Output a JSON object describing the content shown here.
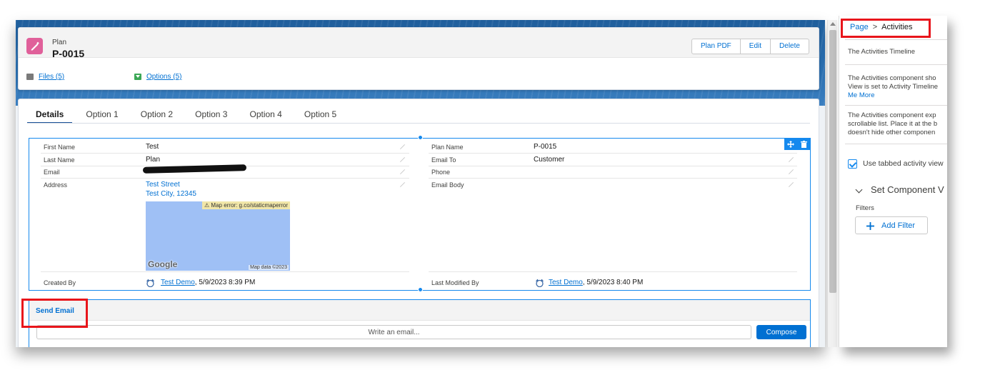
{
  "header": {
    "object_type": "Plan",
    "record_name": "P-0015",
    "actions": [
      "Plan PDF",
      "Edit",
      "Delete"
    ],
    "related_links": [
      {
        "label": "Files (5)",
        "icon": "file-icon",
        "color": "#7a7a7a"
      },
      {
        "label": "Options (5)",
        "icon": "options-icon",
        "color": "#3ba755"
      }
    ]
  },
  "tabs": [
    {
      "label": "Details",
      "active": true
    },
    {
      "label": "Option 1",
      "active": false
    },
    {
      "label": "Option 2",
      "active": false
    },
    {
      "label": "Option 3",
      "active": false
    },
    {
      "label": "Option 4",
      "active": false
    },
    {
      "label": "Option 5",
      "active": false
    }
  ],
  "fields": {
    "first_name": {
      "label": "First Name",
      "value": "Test"
    },
    "last_name": {
      "label": "Last Name",
      "value": "Plan"
    },
    "email": {
      "label": "Email",
      "value": ""
    },
    "address": {
      "label": "Address",
      "line1": "Test Street",
      "line2": "Test City, 12345"
    },
    "plan_name": {
      "label": "Plan Name",
      "value": "P-0015"
    },
    "email_to": {
      "label": "Email To",
      "value": "Customer"
    },
    "phone": {
      "label": "Phone",
      "value": ""
    },
    "email_body": {
      "label": "Email Body",
      "value": ""
    },
    "created_by": {
      "label": "Created By",
      "user": "Test Demo",
      "date": ", 5/9/2023 8:39 PM"
    },
    "last_modified_by": {
      "label": "Last Modified By",
      "user": "Test Demo",
      "date": ", 5/9/2023 8:40 PM"
    }
  },
  "map": {
    "error": "⚠ Map error: g.co/staticmaperror",
    "logo": "Google",
    "attribution": "Map data ©2023"
  },
  "send_email": {
    "title": "Send Email",
    "placeholder": "Write an email...",
    "compose_label": "Compose"
  },
  "right_panel": {
    "breadcrumb": {
      "parent": "Page",
      "separator": ">",
      "current": "Activities"
    },
    "subtitle": "The Activities Timeline",
    "para1": [
      "The Activities component sho",
      "View is set to Activity Timeline",
      "Me More"
    ],
    "para2": [
      "The Activities component exp",
      "scrollable list. Place it at the b",
      "doesn't hide other componen"
    ],
    "checkbox_label": "Use tabbed activity view",
    "checkbox_checked": true,
    "section_title": "Set Component V",
    "filters_label": "Filters",
    "add_filter_label": "Add Filter"
  },
  "colors": {
    "brand_band": "#1f5e9c",
    "link": "#0070d2",
    "record_icon": "#e0609a",
    "highlight": "#e8151b"
  }
}
